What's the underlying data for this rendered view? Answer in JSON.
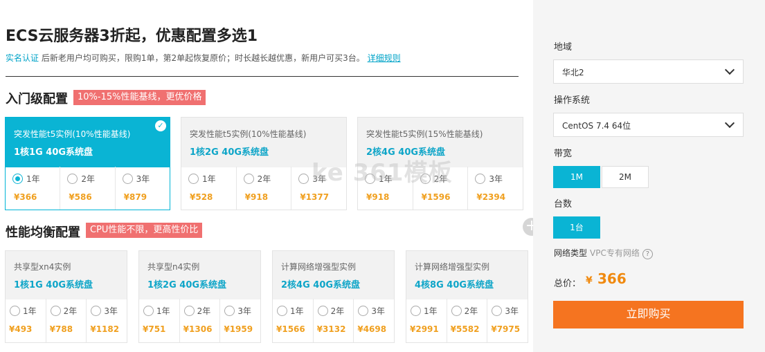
{
  "title": "ECS云服务器3折起，优惠配置多选1",
  "subtitle": {
    "link": "实名认证",
    "text": "后新老用户均可购买，限购1单，第2单起恢复原价；时长越长越优惠，新用户可买3台。",
    "rules_link": "详细规则"
  },
  "sections": [
    {
      "title": "入门级配置",
      "tag": "10%-15%性能基线，更优价格",
      "cards": [
        {
          "name": "突发性能t5实例(10%性能基线)",
          "spec": "1核1G 40G系统盘",
          "selected": true,
          "options": [
            {
              "year": "1年",
              "price": "¥366",
              "checked": true
            },
            {
              "year": "2年",
              "price": "¥586"
            },
            {
              "year": "3年",
              "price": "¥879"
            }
          ]
        },
        {
          "name": "突发性能t5实例(10%性能基线)",
          "spec": "1核2G 40G系统盘",
          "options": [
            {
              "year": "1年",
              "price": "¥528"
            },
            {
              "year": "2年",
              "price": "¥918"
            },
            {
              "year": "3年",
              "price": "¥1377"
            }
          ]
        },
        {
          "name": "突发性能t5实例(15%性能基线)",
          "spec": "2核4G 40G系统盘",
          "options": [
            {
              "year": "1年",
              "price": "¥918"
            },
            {
              "year": "2年",
              "price": "¥1596"
            },
            {
              "year": "3年",
              "price": "¥2394"
            }
          ]
        }
      ]
    },
    {
      "title": "性能均衡配置",
      "tag": "CPU性能不限，更高性价比",
      "cards": [
        {
          "name": "共享型xn4实例",
          "spec": "1核1G 40G系统盘",
          "options": [
            {
              "year": "1年",
              "price": "¥493"
            },
            {
              "year": "2年",
              "price": "¥788"
            },
            {
              "year": "3年",
              "price": "¥1182"
            }
          ]
        },
        {
          "name": "共享型n4实例",
          "spec": "1核2G 40G系统盘",
          "options": [
            {
              "year": "1年",
              "price": "¥751"
            },
            {
              "year": "2年",
              "price": "¥1306"
            },
            {
              "year": "3年",
              "price": "¥1959"
            }
          ]
        },
        {
          "name": "计算网络增强型实例",
          "spec": "2核4G 40G系统盘",
          "options": [
            {
              "year": "1年",
              "price": "¥1566"
            },
            {
              "year": "2年",
              "price": "¥3132"
            },
            {
              "year": "3年",
              "price": "¥4698"
            }
          ]
        },
        {
          "name": "计算网络增强型实例",
          "spec": "4核8G 40G系统盘",
          "options": [
            {
              "year": "1年",
              "price": "¥2991"
            },
            {
              "year": "2年",
              "price": "¥5582"
            },
            {
              "year": "3年",
              "price": "¥7975"
            }
          ]
        }
      ]
    }
  ],
  "watermark": "ke 361模板",
  "panel": {
    "region_label": "地域",
    "region_value": "华北2",
    "os_label": "操作系统",
    "os_value": "CentOS 7.4 64位",
    "bandwidth_label": "带宽",
    "bandwidth_options": [
      "1M",
      "2M"
    ],
    "count_label": "台数",
    "count_value": "1台",
    "network_label": "网络类型",
    "network_value": "VPC专有网络",
    "help_icon": "question-icon",
    "total_label": "总价：",
    "currency": "¥",
    "total_value": "366",
    "buy_label": "立即购买"
  },
  "colors": {
    "accent": "#0ab4d4",
    "price": "#f0a020",
    "tag": "#f07070",
    "buy": "#f57420"
  }
}
